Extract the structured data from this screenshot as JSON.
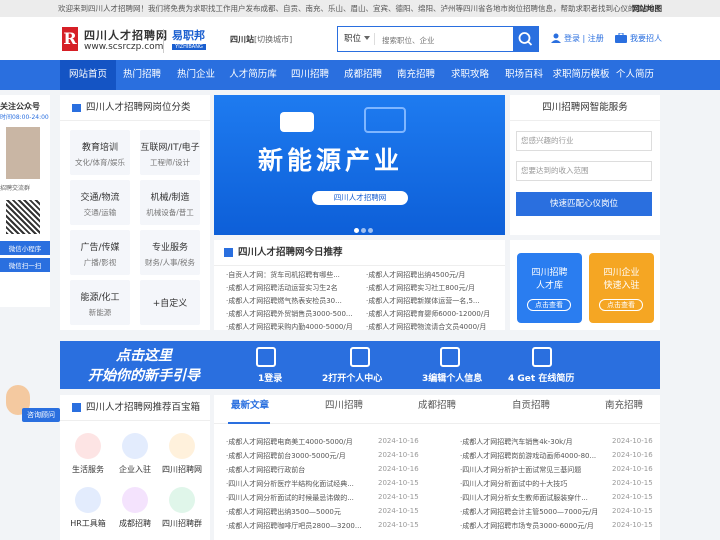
{
  "topbar": {
    "welcome": "欢迎来到四川人才招聘网！我们将免费为求职找工作用户发布成都、自贡、南充、乐山、眉山、宜宾、德阳、绵阳、泸州等四川省各地市岗位招聘信息，帮助求职者找到心仪的工作。",
    "sitemap": "网站地图"
  },
  "header": {
    "logo_letter": "R",
    "site_title": "四川人才招聘网",
    "site_url": "www.scsrczp.com",
    "partner_name": "易职邦",
    "partner_sub": "YIZHIBANG",
    "station": "四川站",
    "station_switch": "[切换城市]"
  },
  "search": {
    "type": "职位",
    "placeholder": "搜索职位、企业",
    "login": "登录",
    "register": "注册",
    "recruit": "我要招人"
  },
  "nav": [
    "网站首页",
    "热门招聘",
    "热门企业",
    "人才简历库",
    "四川招聘",
    "成都招聘",
    "南充招聘",
    "求职攻略",
    "职场百科",
    "求职简历模板",
    "个人简历"
  ],
  "left_side": {
    "follow": "关注公众号",
    "hours": "时间08:00-24:00",
    "group": "招聘交流群",
    "mini": "微信小程序",
    "scan": "微信扫一扫",
    "consult": "咨询顾问"
  },
  "category": {
    "title": "四川人才招聘网岗位分类",
    "items": [
      {
        "name": "教育培训",
        "sub": "文化/体育/娱乐"
      },
      {
        "name": "互联网/IT/电子",
        "sub": "工程师/设计"
      },
      {
        "name": "交通/物流",
        "sub": "交通/运输"
      },
      {
        "name": "机械/制造",
        "sub": "机械设备/普工"
      },
      {
        "name": "广告/传媒",
        "sub": "广播/影视"
      },
      {
        "name": "专业服务",
        "sub": "财务/人事/税务"
      },
      {
        "name": "能源/化工",
        "sub": "新能源"
      },
      {
        "name": "+自定义",
        "sub": ""
      }
    ]
  },
  "banner": {
    "headline": "新能源产业",
    "tag": "四川人才招聘网"
  },
  "news": {
    "title": "四川人才招聘网今日推荐",
    "left": [
      "·自贡人才网：货车司机招聘有哪些...",
      "·成都人才网招聘活动运营实习生2名",
      "·成都人才网招聘燃气热表安检员30...",
      "·成都人才网招聘外贸销售员3000-500...",
      "·成都人才网招聘采购内勤4000-5000/月"
    ],
    "right": [
      "·成都人才网招聘出纳4500元/月",
      "·成都人才网招聘实习社工800元/月",
      "·成都人才网招聘新媒体运营一名,5...",
      "·成都人才网招聘育婴师6000-12000/月",
      "·成都人才网招聘物流请合文员4000/月"
    ]
  },
  "ai": {
    "title": "四川招聘网智能服务",
    "industry": "您感兴趣的行业",
    "salary": "您要达到的收入范围",
    "match": "快速匹配心仪岗位"
  },
  "tiles": [
    {
      "line1": "四川招聘",
      "line2": "人才库",
      "btn": "点击查看"
    },
    {
      "line1": "四川企业",
      "line2": "快速入驻",
      "btn": "点击查看"
    }
  ],
  "guide": {
    "line1": "点击这里",
    "line2": "开始你的新手引导",
    "steps": [
      "1登录",
      "2打开个人中心",
      "3编辑个人信息",
      "4 Get 在线简历"
    ]
  },
  "toolbox": {
    "title": "四川人才招聘网推荐百宝箱",
    "items": [
      "生活服务",
      "企业入驻",
      "四川招聘网",
      "HR工具箱",
      "成都招聘",
      "四川招聘群"
    ]
  },
  "listing": {
    "tabs": [
      "最新文章",
      "四川招聘",
      "成都招聘",
      "自贡招聘",
      "南充招聘"
    ],
    "left": [
      {
        "t": "·成都人才网招聘电商美工4000-5000/月",
        "d": "2024-10-16"
      },
      {
        "t": "·成都人才网招聘前台3000-5000元/月",
        "d": "2024-10-16"
      },
      {
        "t": "·成都人才网招聘行政前台",
        "d": "2024-10-16"
      },
      {
        "t": "·四川人才网分析医疗半结构化面试经典...",
        "d": "2024-10-15"
      },
      {
        "t": "·四川人才网分析面试的时候最忌讳做的...",
        "d": "2024-10-15"
      },
      {
        "t": "·成都人才网招聘出纳3500—5000元",
        "d": "2024-10-15"
      },
      {
        "t": "·成都人才网招聘咖啡厅吧员2800—3200...",
        "d": "2024-10-15"
      }
    ],
    "right": [
      {
        "t": "·成都人才网招聘汽车销售4k-30k/月",
        "d": "2024-10-16"
      },
      {
        "t": "·成都人才网招聘岗前游戏动画师4000-80...",
        "d": "2024-10-16"
      },
      {
        "t": "·四川人才网分析护士面试常见三基问题",
        "d": "2024-10-16"
      },
      {
        "t": "·四川人才网分析面试中的十大技巧",
        "d": "2024-10-15"
      },
      {
        "t": "·四川人才网分析女生教师面试服装穿什...",
        "d": "2024-10-15"
      },
      {
        "t": "·成都人才网招聘会计主管5000—7000元/月",
        "d": "2024-10-15"
      },
      {
        "t": "·成都人才网招聘市场专员3000-6000元/月",
        "d": "2024-10-15"
      }
    ]
  },
  "colors": {
    "primary": "#2a6fdf",
    "nav_active": "#1454c4",
    "tile1": "#2a7df0",
    "tile2": "#f5a623"
  }
}
